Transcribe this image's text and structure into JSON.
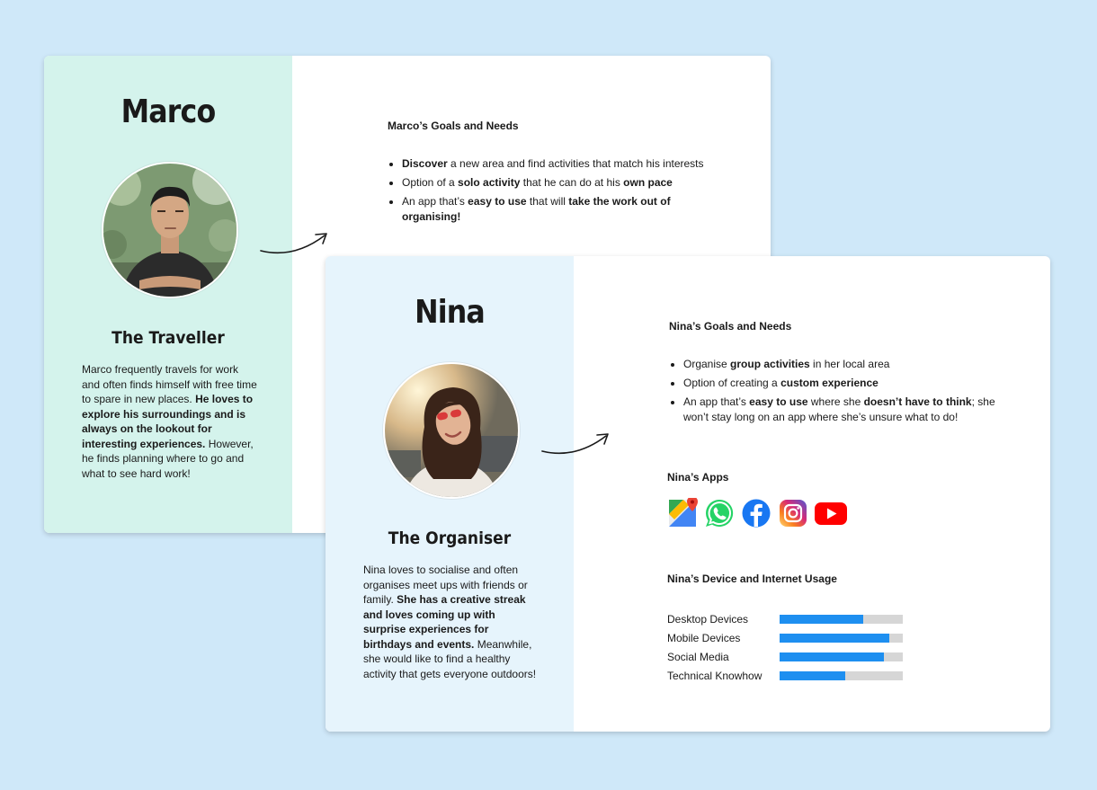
{
  "marco": {
    "name": "Marco",
    "role": "The Traveller",
    "bio": [
      {
        "text": "Marco frequently travels for work and often finds himself with free time to spare in new places. ",
        "bold": false
      },
      {
        "text": "He loves to explore his surroundings and is always on the lookout for interesting experiences.",
        "bold": true
      },
      {
        "text": " However, he finds planning where to go and what to see hard work!",
        "bold": false
      }
    ],
    "goals_title": "Marco’s Goals and Needs",
    "goals": [
      [
        {
          "text": "Discover",
          "bold": true
        },
        {
          "text": " a new area and find activities that match his interests",
          "bold": false
        }
      ],
      [
        {
          "text": "Option of a ",
          "bold": false
        },
        {
          "text": "solo activity",
          "bold": true
        },
        {
          "text": " that he can do at his ",
          "bold": false
        },
        {
          "text": "own pace",
          "bold": true
        }
      ],
      [
        {
          "text": "An app that’s ",
          "bold": false
        },
        {
          "text": "easy to use",
          "bold": true
        },
        {
          "text": " that will ",
          "bold": false
        },
        {
          "text": "take the work out of organising!",
          "bold": true
        }
      ]
    ]
  },
  "nina": {
    "name": "Nina",
    "role": "The Organiser",
    "bio": [
      {
        "text": "Nina loves to socialise and often organises meet ups with friends or family. ",
        "bold": false
      },
      {
        "text": "She has a creative streak and loves coming up with surprise experiences for birthdays and events.",
        "bold": true
      },
      {
        "text": " Meanwhile, she would like to find a healthy activity that gets everyone outdoors!",
        "bold": false
      }
    ],
    "goals_title": "Nina’s Goals and Needs",
    "goals": [
      [
        {
          "text": "Organise ",
          "bold": false
        },
        {
          "text": "group activities",
          "bold": true
        },
        {
          "text": " in her local area",
          "bold": false
        }
      ],
      [
        {
          "text": "Option of creating a ",
          "bold": false
        },
        {
          "text": "custom experience",
          "bold": true
        }
      ],
      [
        {
          "text": "An app that’s ",
          "bold": false
        },
        {
          "text": "easy to use",
          "bold": true
        },
        {
          "text": " where she ",
          "bold": false
        },
        {
          "text": "doesn’t have to think",
          "bold": true
        },
        {
          "text": "; she won’t stay long on an app where she’s unsure what to do!",
          "bold": false
        }
      ]
    ],
    "apps_title": "Nina’s Apps",
    "apps": [
      "google-maps-icon",
      "whatsapp-icon",
      "facebook-icon",
      "instagram-icon",
      "youtube-icon"
    ],
    "usage_title": "Nina’s Device and Internet Usage",
    "usage": [
      {
        "label": "Desktop Devices",
        "value": 0.68
      },
      {
        "label": "Mobile Devices",
        "value": 0.89
      },
      {
        "label": "Social Media",
        "value": 0.85
      },
      {
        "label": "Technical Knowhow",
        "value": 0.53
      }
    ]
  },
  "colors": {
    "background": "#cfe8f9",
    "marco_panel": "#d4f3ec",
    "nina_panel": "#e6f4fc",
    "bar_fill": "#1e8ff0",
    "bar_track": "#d6d6d6"
  }
}
